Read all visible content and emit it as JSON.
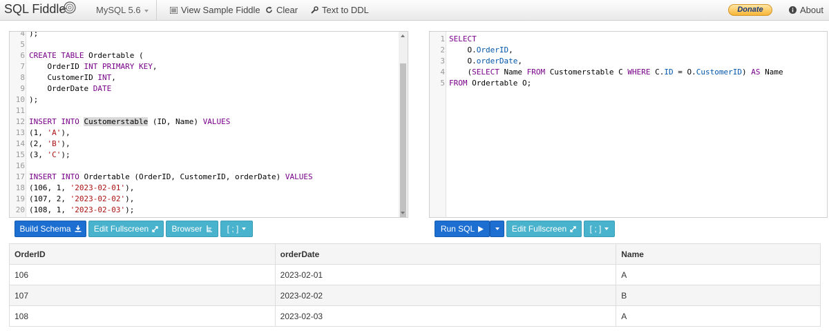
{
  "navbar": {
    "brand": "SQL Fiddle",
    "database": "MySQL 5.6",
    "view_sample": "View Sample Fiddle",
    "clear": "Clear",
    "text_to_ddl": "Text to DDL",
    "donate": "Donate",
    "about": "About"
  },
  "schema_editor": {
    "lines": [
      {
        "n": "4",
        "parts": [
          {
            "t": ");",
            "c": ""
          }
        ]
      },
      {
        "n": "5",
        "parts": []
      },
      {
        "n": "6",
        "parts": [
          {
            "t": "CREATE TABLE",
            "c": "kw"
          },
          {
            "t": " Ordertable (",
            "c": ""
          }
        ]
      },
      {
        "n": "7",
        "parts": [
          {
            "t": "    OrderID ",
            "c": ""
          },
          {
            "t": "INT PRIMARY KEY",
            "c": "kw"
          },
          {
            "t": ",",
            "c": ""
          }
        ]
      },
      {
        "n": "8",
        "parts": [
          {
            "t": "    CustomerID ",
            "c": ""
          },
          {
            "t": "INT",
            "c": "kw"
          },
          {
            "t": ",",
            "c": ""
          }
        ]
      },
      {
        "n": "9",
        "parts": [
          {
            "t": "    OrderDate ",
            "c": ""
          },
          {
            "t": "DATE",
            "c": "kw"
          }
        ]
      },
      {
        "n": "10",
        "parts": [
          {
            "t": ");",
            "c": ""
          }
        ]
      },
      {
        "n": "11",
        "parts": []
      },
      {
        "n": "12",
        "parts": [
          {
            "t": "INSERT INTO",
            "c": "kw"
          },
          {
            "t": " ",
            "c": ""
          },
          {
            "t": "Customerstable",
            "c": "hl"
          },
          {
            "t": " (ID, Name) ",
            "c": ""
          },
          {
            "t": "VALUES",
            "c": "kw"
          }
        ]
      },
      {
        "n": "13",
        "parts": [
          {
            "t": "(1, ",
            "c": ""
          },
          {
            "t": "'A'",
            "c": "str"
          },
          {
            "t": "),",
            "c": ""
          }
        ]
      },
      {
        "n": "14",
        "parts": [
          {
            "t": "(2, ",
            "c": ""
          },
          {
            "t": "'B'",
            "c": "str"
          },
          {
            "t": "),",
            "c": ""
          }
        ]
      },
      {
        "n": "15",
        "parts": [
          {
            "t": "(3, ",
            "c": ""
          },
          {
            "t": "'C'",
            "c": "str"
          },
          {
            "t": ");",
            "c": ""
          }
        ]
      },
      {
        "n": "16",
        "parts": []
      },
      {
        "n": "17",
        "parts": [
          {
            "t": "INSERT INTO",
            "c": "kw"
          },
          {
            "t": " Ordertable (OrderID, CustomerID, orderDate) ",
            "c": ""
          },
          {
            "t": "VALUES",
            "c": "kw"
          }
        ]
      },
      {
        "n": "18",
        "parts": [
          {
            "t": "(106, 1, ",
            "c": ""
          },
          {
            "t": "'2023-02-01'",
            "c": "str"
          },
          {
            "t": "),",
            "c": ""
          }
        ]
      },
      {
        "n": "19",
        "parts": [
          {
            "t": "(107, 2, ",
            "c": ""
          },
          {
            "t": "'2023-02-02'",
            "c": "str"
          },
          {
            "t": "),",
            "c": ""
          }
        ]
      },
      {
        "n": "20",
        "parts": [
          {
            "t": "(108, 1, ",
            "c": ""
          },
          {
            "t": "'2023-02-03'",
            "c": "str"
          },
          {
            "t": ");",
            "c": ""
          }
        ]
      }
    ]
  },
  "query_editor": {
    "lines": [
      {
        "n": "1",
        "parts": [
          {
            "t": "SELECT",
            "c": "kw"
          }
        ]
      },
      {
        "n": "2",
        "parts": [
          {
            "t": "    O.",
            "c": ""
          },
          {
            "t": "OrderID",
            "c": "prop"
          },
          {
            "t": ",",
            "c": ""
          }
        ]
      },
      {
        "n": "3",
        "parts": [
          {
            "t": "    O.",
            "c": ""
          },
          {
            "t": "orderDate",
            "c": "prop"
          },
          {
            "t": ",",
            "c": ""
          }
        ]
      },
      {
        "n": "4",
        "parts": [
          {
            "t": "    (",
            "c": ""
          },
          {
            "t": "SELECT",
            "c": "kw"
          },
          {
            "t": " Name ",
            "c": ""
          },
          {
            "t": "FROM",
            "c": "kw"
          },
          {
            "t": " Customerstable C ",
            "c": ""
          },
          {
            "t": "WHERE",
            "c": "kw"
          },
          {
            "t": " C.",
            "c": ""
          },
          {
            "t": "ID",
            "c": "prop"
          },
          {
            "t": " = O.",
            "c": ""
          },
          {
            "t": "CustomerID",
            "c": "prop"
          },
          {
            "t": ") ",
            "c": ""
          },
          {
            "t": "AS",
            "c": "kw"
          },
          {
            "t": " Name",
            "c": ""
          }
        ]
      },
      {
        "n": "5",
        "parts": [
          {
            "t": "FROM",
            "c": "kw"
          },
          {
            "t": " Ordertable O;",
            "c": ""
          }
        ]
      }
    ]
  },
  "schema_buttons": {
    "build": "Build Schema",
    "edit_fullscreen": "Edit Fullscreen",
    "browser": "Browser",
    "delimiter": "[ ; ]"
  },
  "query_buttons": {
    "run": "Run SQL",
    "edit_fullscreen": "Edit Fullscreen",
    "delimiter": "[ ; ]"
  },
  "results": {
    "columns": [
      "OrderID",
      "orderDate",
      "Name"
    ],
    "rows": [
      [
        "106",
        "2023-02-01",
        "A"
      ],
      [
        "107",
        "2023-02-02",
        "B"
      ],
      [
        "108",
        "2023-02-03",
        "A"
      ]
    ]
  },
  "colors": {
    "primary_button": "#1c6fd1",
    "info_button": "#49b2cc",
    "keyword": "#770088",
    "string": "#aa1111",
    "property": "#0055aa"
  }
}
